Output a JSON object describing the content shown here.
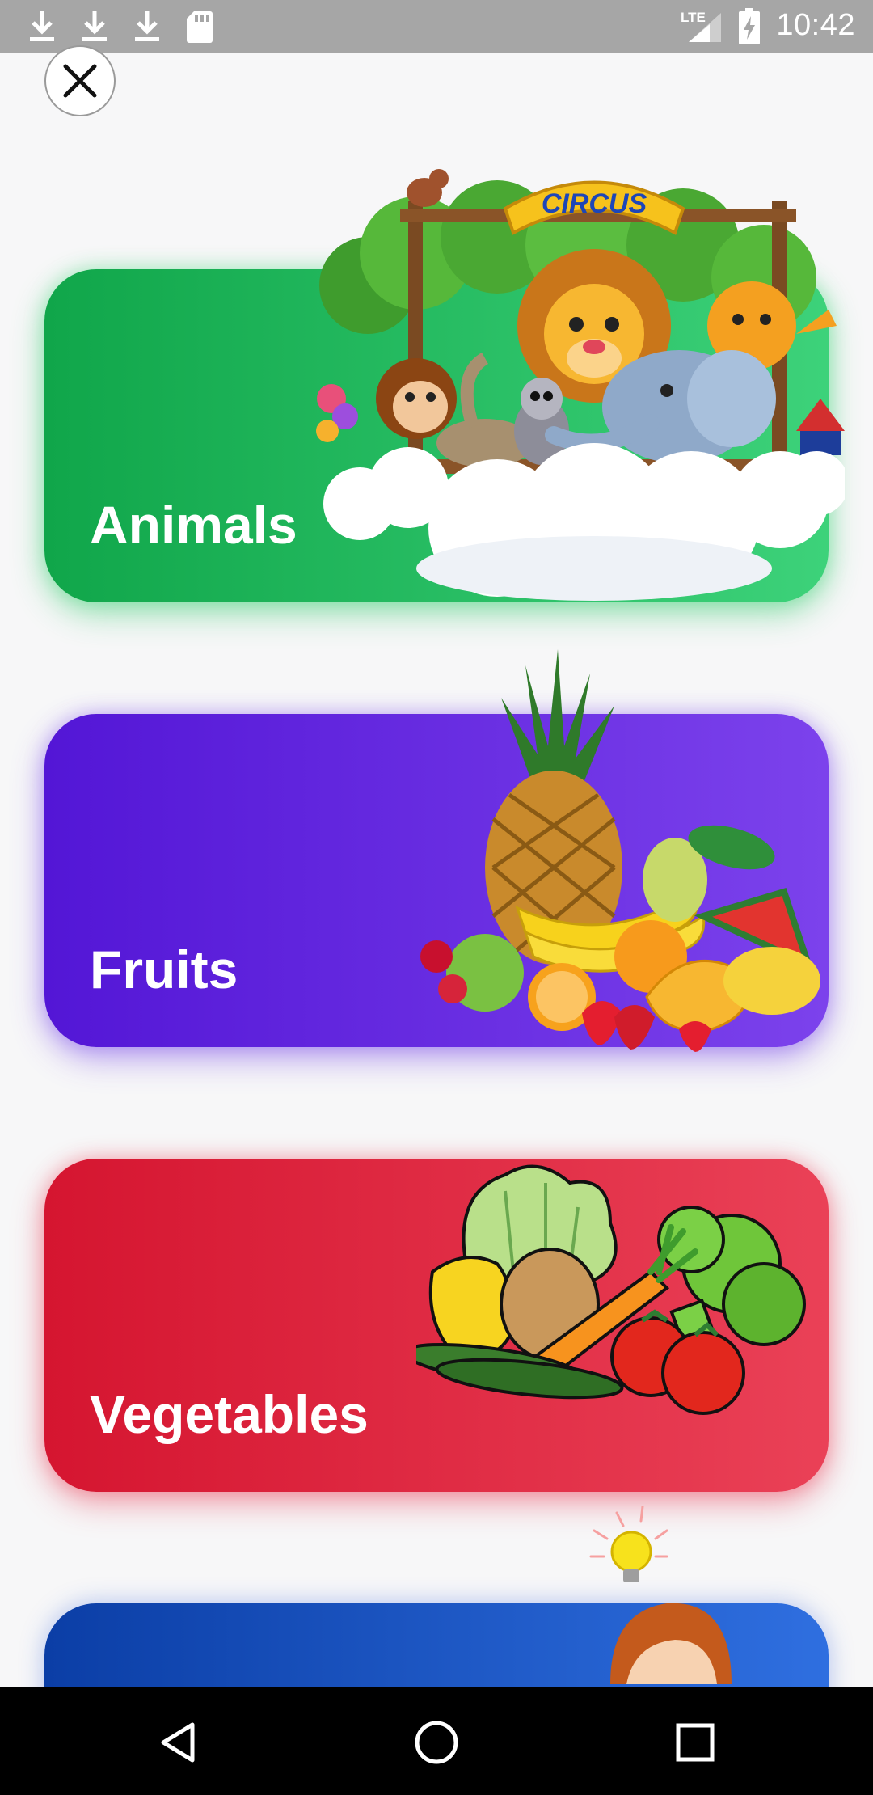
{
  "status_bar": {
    "time": "10:42",
    "network": "LTE",
    "icons": [
      "download-icon",
      "download-icon",
      "download-icon",
      "sd-card-icon",
      "signal-icon",
      "battery-charging-icon"
    ]
  },
  "close_button": {
    "icon": "close-icon"
  },
  "categories": [
    {
      "label": "Animals",
      "color_start": "#10a64a",
      "color_end": "#3dd27a",
      "banner_text": "CIRCUS"
    },
    {
      "label": "Fruits",
      "color_start": "#5316d6",
      "color_end": "#7c42ec"
    },
    {
      "label": "Vegetables",
      "color_start": "#d51530",
      "color_end": "#ea4157"
    },
    {
      "label": "",
      "color_start": "#0b3ea6",
      "color_end": "#2f6fe0"
    }
  ],
  "nav_bar": {
    "back_icon": "back-triangle-icon",
    "home_icon": "home-circle-icon",
    "recents_icon": "recents-square-icon"
  }
}
